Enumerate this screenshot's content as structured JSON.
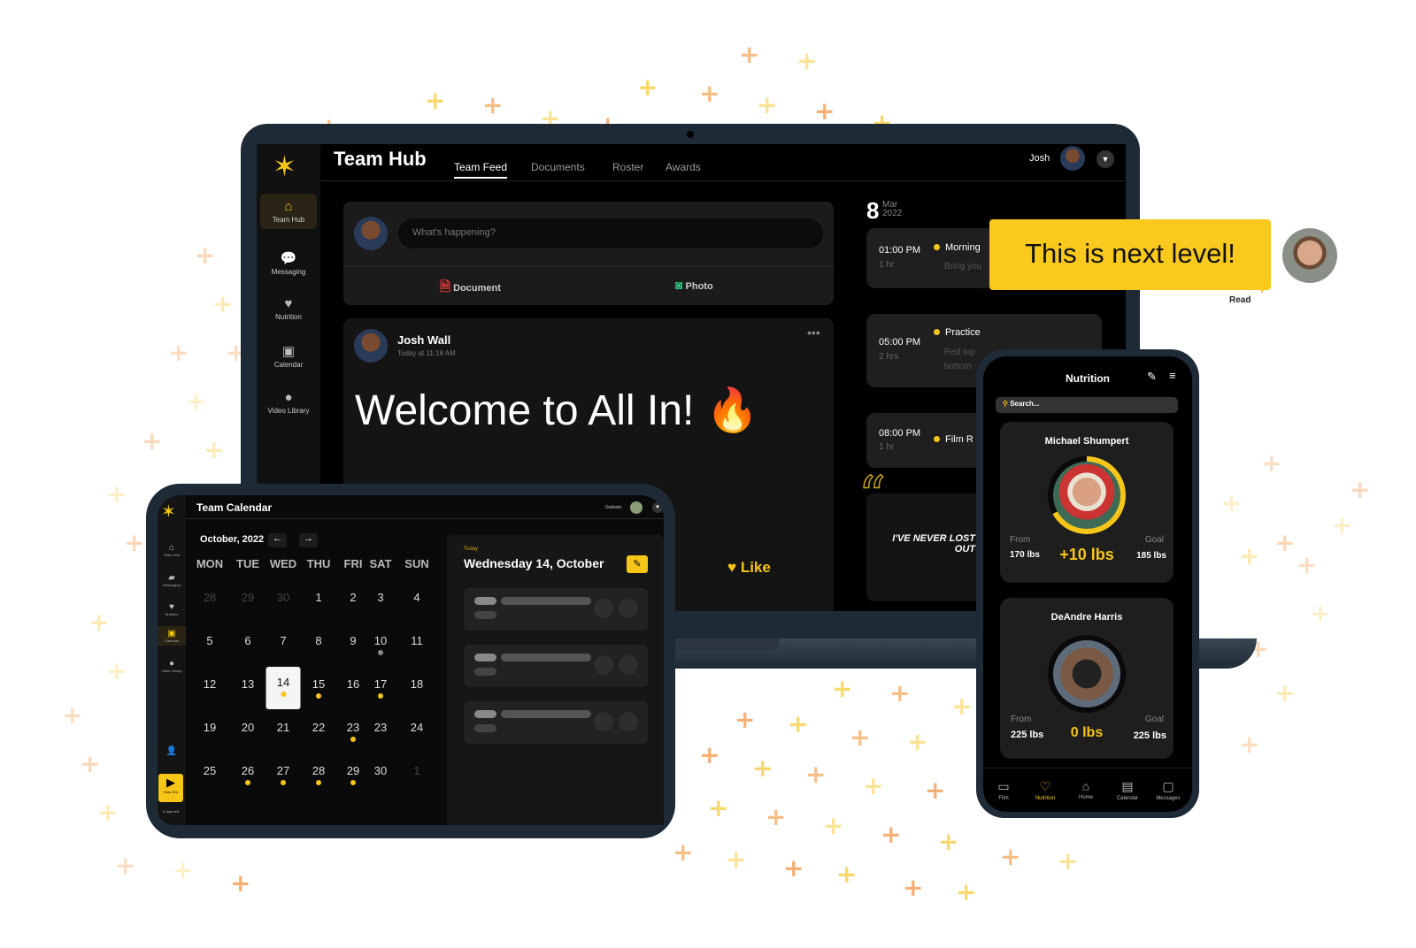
{
  "colors": {
    "accent": "#f5c518",
    "background": "#000000",
    "bezel": "#1e2a35"
  },
  "laptop": {
    "title": "Team Hub",
    "tabs": [
      "Team Feed",
      "Documents",
      "Roster",
      "Awards"
    ],
    "active_tab": "Team Feed",
    "user": "Josh",
    "sidebar": [
      {
        "label": "Team Hub",
        "icon": "home-icon"
      },
      {
        "label": "Messaging",
        "icon": "chat-icon"
      },
      {
        "label": "Nutrition",
        "icon": "heart-pulse-icon"
      },
      {
        "label": "Calendar",
        "icon": "calendar-icon"
      },
      {
        "label": "Video Library",
        "icon": "location-pin-icon"
      }
    ],
    "composer": {
      "placeholder": "What's happening?",
      "document_label": "Document",
      "photo_label": "Photo"
    },
    "post": {
      "author": "Josh Wall",
      "time": "Today at 11:18 AM",
      "body": "Welcome to All In! 🔥",
      "like_label": "Like"
    },
    "schedule": {
      "day": "8",
      "month": "Mar",
      "year": "2022",
      "events": [
        {
          "time": "01:00 PM",
          "duration": "1 hr",
          "name": "Morning",
          "note": "Bring you"
        },
        {
          "time": "05:00 PM",
          "duration": "2 hrs",
          "name": "Practice",
          "note": "Red top",
          "note2": "bottom"
        },
        {
          "time": "08:00 PM",
          "duration": "1 hr",
          "name": "Film R"
        }
      ],
      "quote_line1": "I'VE NEVER LOST",
      "quote_line2": "OUT"
    }
  },
  "bubble": {
    "text": "This is next level!",
    "status": "Read"
  },
  "tablet": {
    "title": "Team Calendar",
    "user": "Graham",
    "sidebar": [
      "Team Hub",
      "Messaging",
      "Nutrition",
      "Calendar",
      "Video Library"
    ],
    "howto": "How-To's",
    "days_left": "6 days left",
    "month": "October, 2022",
    "weekdays": [
      "MON",
      "TUE",
      "WED",
      "THU",
      "FRI",
      "SAT",
      "SUN"
    ],
    "weeks": [
      [
        {
          "d": "28",
          "dim": true
        },
        {
          "d": "29",
          "dim": true
        },
        {
          "d": "30",
          "dim": true
        },
        {
          "d": "1"
        },
        {
          "d": "2"
        },
        {
          "d": "3"
        },
        {
          "d": "4"
        }
      ],
      [
        {
          "d": "5"
        },
        {
          "d": "6"
        },
        {
          "d": "7"
        },
        {
          "d": "8"
        },
        {
          "d": "9"
        },
        {
          "d": "10",
          "dot": "grey"
        },
        {
          "d": "11"
        }
      ],
      [
        {
          "d": "12"
        },
        {
          "d": "13"
        },
        {
          "d": "14",
          "dot": "yellow",
          "selected": true
        },
        {
          "d": "15",
          "dot": "yellow"
        },
        {
          "d": "16"
        },
        {
          "d": "17",
          "dot": "yellow"
        },
        {
          "d": "18"
        }
      ],
      [
        {
          "d": "19"
        },
        {
          "d": "20"
        },
        {
          "d": "21"
        },
        {
          "d": "22"
        },
        {
          "d": "23",
          "dot": "yellow"
        },
        {
          "d": "23"
        },
        {
          "d": "24"
        }
      ],
      [
        {
          "d": "25"
        },
        {
          "d": "26",
          "dot": "yellow"
        },
        {
          "d": "27",
          "dot": "yellow"
        },
        {
          "d": "28",
          "dot": "yellow"
        },
        {
          "d": "29",
          "dot": "yellow"
        },
        {
          "d": "30"
        },
        {
          "d": "1",
          "dim": true
        }
      ]
    ],
    "today_label": "Today",
    "selected_date": "Wednesday 14, October"
  },
  "phone": {
    "title": "Nutrition",
    "search_placeholder": "Search...",
    "athletes": [
      {
        "name": "Michael Shumpert",
        "from_label": "From",
        "from": "170 lbs",
        "change": "+10 lbs",
        "goal_label": "Goal",
        "goal": "185 lbs",
        "progress": 0.67
      },
      {
        "name": "DeAndre Harris",
        "from_label": "From",
        "from": "225 lbs",
        "change": "0 lbs",
        "goal_label": "Goal",
        "goal": "225 lbs",
        "progress": 0
      }
    ],
    "nav": [
      {
        "label": "Film",
        "icon": "video-icon"
      },
      {
        "label": "Nutrition",
        "icon": "heart-icon",
        "active": true
      },
      {
        "label": "Home",
        "icon": "home-icon"
      },
      {
        "label": "Calendar",
        "icon": "calendar-icon"
      },
      {
        "label": "Messages",
        "icon": "message-icon"
      }
    ]
  }
}
